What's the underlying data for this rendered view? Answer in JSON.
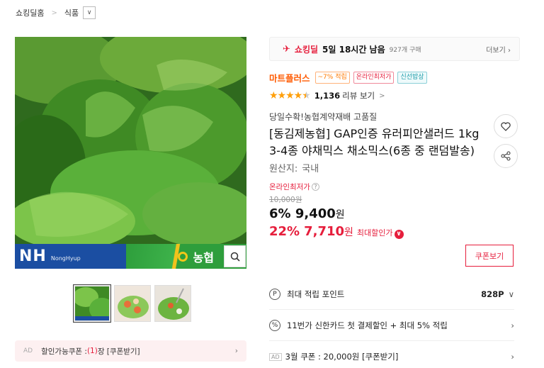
{
  "breadcrumb": {
    "items": [
      "쇼킹딜홈",
      "식품"
    ]
  },
  "product_image": {
    "banner_brand": "NH",
    "banner_sub": "NongHyup",
    "banner_right": "농협"
  },
  "coupon_bar": {
    "ad": "AD",
    "text_before": "할인가능쿠폰 : ",
    "count": "(1)",
    "text_after": "장 [쿠폰받기]"
  },
  "deal": {
    "label": "쇼킹딜",
    "time_left": "5일 18시간 남음",
    "purchased": "927개 구매",
    "more": "더보기"
  },
  "badges": {
    "mart": "마트플러스",
    "points": "~7% 적립",
    "lowest": "온라인최저가",
    "fresh": "신선밥상"
  },
  "rating": {
    "stars": 4.5,
    "count": "1,136",
    "label": "리뷰 보기"
  },
  "product": {
    "subtitle": "당일수확!농협계약재배 고품질",
    "title": "[동김제농협] GAP인증 유러피안샐러드 1kg 3-4종 야채믹스 채소믹스(6종 중 랜덤발송)",
    "origin_label": "원산지:",
    "origin_value": "국내"
  },
  "price": {
    "lowest_label": "온라인최저가",
    "original": "10,000원",
    "sale_pct": "6%",
    "sale_price": "9,400",
    "won": "원",
    "max_pct": "22%",
    "max_price": "7,710",
    "max_label": "최대할인가"
  },
  "coupon_button": "쿠폰보기",
  "info_rows": {
    "points_label": "최대 적립 포인트",
    "points_value": "828P",
    "card_label": "11번가 신한카드 첫 결제할인 + 최대 5% 적립",
    "march_ad": "AD",
    "march_label": "3월 쿠폰 : 20,000원 [쿠폰받기]"
  },
  "colors": {
    "accent_red": "#e61e3c",
    "mart_orange": "#ff5a00",
    "nh_blue": "#1b4ea2",
    "star": "#ff9f0a"
  }
}
